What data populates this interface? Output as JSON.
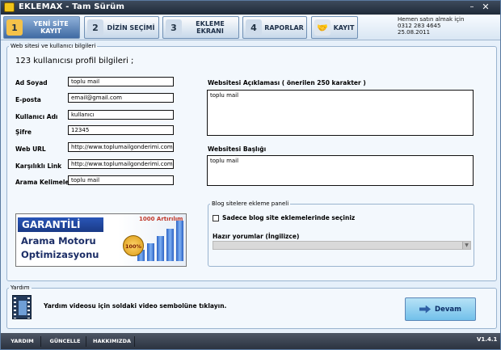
{
  "window": {
    "title": "EKLEMAX - Tam Sürüm"
  },
  "toolbar": {
    "tabs": [
      {
        "num": "1",
        "label": "YENİ SİTE KAYIT"
      },
      {
        "num": "2",
        "label": "DİZİN SEÇİMİ"
      },
      {
        "num": "3",
        "label": "EKLEME EKRANI"
      },
      {
        "num": "4",
        "label": "RAPORLAR"
      },
      {
        "num": "",
        "label": "KAYIT"
      }
    ],
    "contact": [
      "Hemen satın almak için",
      "0312 283 4645",
      "25.08.2011"
    ]
  },
  "site_group": {
    "legend": "Web sitesi ve kullanıcı bilgileri",
    "heading": "123 kullanıcısı profil bilgileri ;",
    "fields": [
      {
        "label": "Ad Soyad",
        "value": "toplu mail"
      },
      {
        "label": "E-posta",
        "value": "email@gmail.com"
      },
      {
        "label": "Kullanıcı Adı",
        "value": "kullanıcı"
      },
      {
        "label": "Şifre",
        "value": "12345"
      },
      {
        "label": "Web URL",
        "value": "http://www.toplumailgonderimi.com"
      },
      {
        "label": "Karşılıklı Link",
        "value": "http://www.toplumailgonderimi.com"
      },
      {
        "label": "Arama Kelimeleri",
        "value": "toplu mail"
      }
    ],
    "desc_label": "Websitesi Açıklaması ( önerilen 250 karakter )",
    "desc_value": "toplu mail",
    "title_label": "Websitesi Başlığı",
    "title_value": "toplu mail"
  },
  "promo": {
    "line1": "GARANTİLİ",
    "line2": "Arama Motoru",
    "line3": "Optimizasyonu",
    "badge": "100%",
    "top": "1000 Artırılım"
  },
  "blog": {
    "legend": "Blog sitelere ekleme paneli",
    "checkbox_label": "Sadece blog site eklemelerinde seçiniz",
    "select_label": "Hazır yorumlar (İngilizce)",
    "select_value": ""
  },
  "help": {
    "legend": "Yardım",
    "text": "Yardım videosu için soldaki video sembolüne tıklayın.",
    "next_button": "Devam"
  },
  "statusbar": {
    "items": [
      "YARDIM",
      "GÜNCELLE",
      "HAKKIMIZDA"
    ],
    "version": "V1.4.1"
  }
}
